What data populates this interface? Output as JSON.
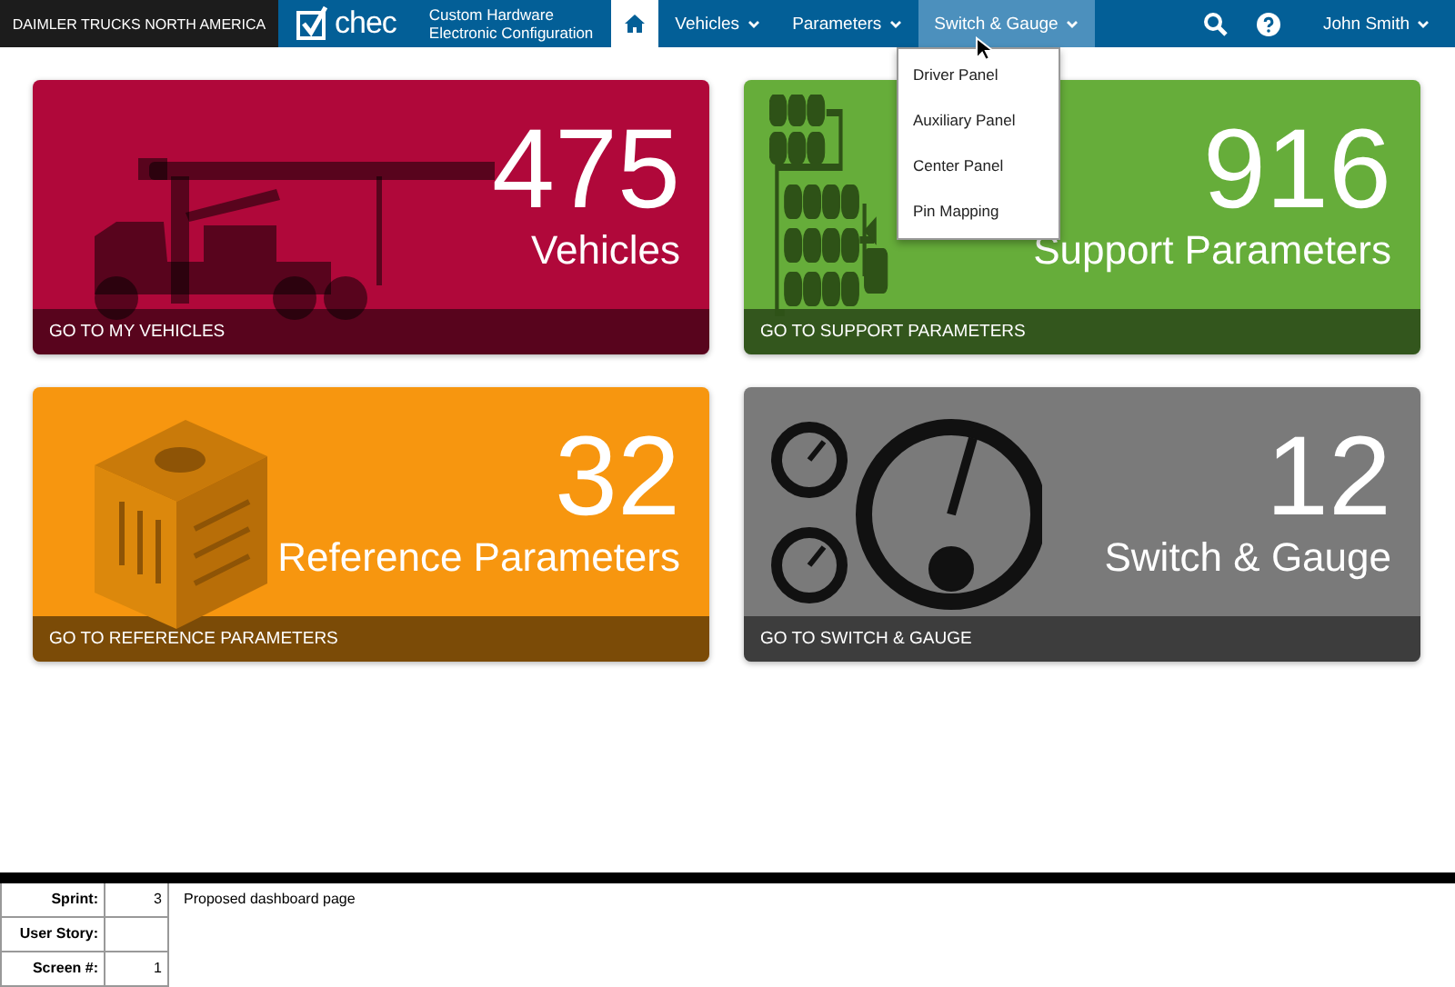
{
  "brand": "DAIMLER TRUCKS NORTH AMERICA",
  "logo": {
    "word": "chec",
    "tagline_1": "Custom Hardware",
    "tagline_2": "Electronic Configuration"
  },
  "nav": [
    {
      "kind": "home",
      "selected": false
    },
    {
      "kind": "menu",
      "label": "Vehicles",
      "selected": false
    },
    {
      "kind": "menu",
      "label": "Parameters",
      "selected": false
    },
    {
      "kind": "menu",
      "label": "Switch & Gauge",
      "selected": true
    }
  ],
  "user": "John Smith",
  "dropdown": [
    "Driver Panel",
    "Auxiliary Panel",
    "Center Panel",
    "Pin Mapping"
  ],
  "cards": [
    {
      "kind": "truck",
      "count": "475",
      "label": "Vehicles",
      "link": "GO TO MY VEHICLES",
      "color": "#b0083a"
    },
    {
      "kind": "circuit",
      "count": "916",
      "label": "Support Parameters",
      "link": "GO TO SUPPORT PARAMETERS",
      "color": "#66ad3a"
    },
    {
      "kind": "cube",
      "count": "32",
      "label": "Reference Parameters",
      "link": "GO TO REFERENCE PARAMETERS",
      "color": "#f7960f"
    },
    {
      "kind": "gauge",
      "count": "12",
      "label": "Switch & Gauge",
      "link": "GO TO SWITCH & GAUGE",
      "color": "#7a7a7a"
    }
  ],
  "notes": {
    "rows": [
      {
        "label": "Sprint:",
        "value": "3"
      },
      {
        "label": "User Story:"
      },
      {
        "label": "Screen #:",
        "value": "1"
      }
    ],
    "description": "Proposed dashboard page"
  }
}
